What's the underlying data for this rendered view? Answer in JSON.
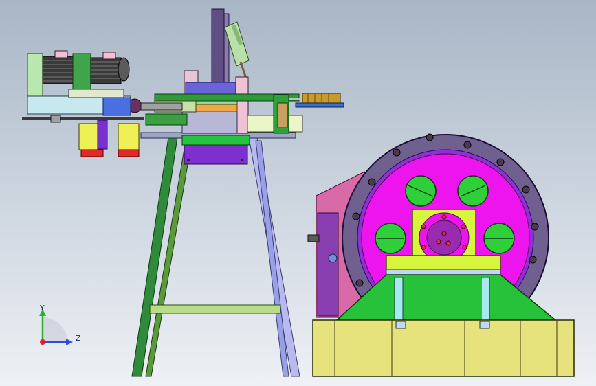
{
  "viewport": {
    "name": "cad-graphics-area",
    "background_top": "#a9b6c6",
    "background_bottom": "#eef1f5"
  },
  "triad": {
    "x_label": "Z",
    "y_label": "Y",
    "colors": {
      "y": "#2cb02c",
      "z": "#2b4fd6",
      "origin": "#e0202a"
    }
  },
  "model": {
    "palette": {
      "magenta": "#ee12ee",
      "dark_purple": "#6c5c94",
      "lime": "#d6f53c",
      "green": "#27c23a",
      "yellow_base": "#e4e07a",
      "violet": "#8e2fd6",
      "light_blue": "#b9d3f0",
      "pink": "#e06aa8",
      "olive_frame": "#1f7a3a",
      "lavender_leg": "#aeb2f0",
      "orange": "#f1a84a"
    },
    "icons": [
      "coordinate-triad-icon"
    ]
  }
}
